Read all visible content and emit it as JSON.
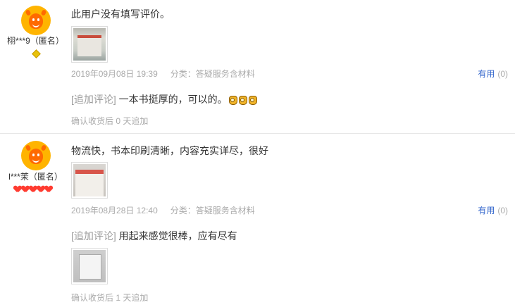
{
  "reviews": [
    {
      "username": "栩***9（匿名）",
      "rank_icons": [
        "diamond-icon"
      ],
      "content": "此用户没有填写评价。",
      "date": "2019年09月08日 19:39",
      "category": "分类：答疑服务含材料",
      "useful_label": "有用",
      "useful_count": "(0)",
      "append_label": "[追加评论]",
      "append_text": "一本书挺厚的，可以的。",
      "append_emoji_count": 3,
      "append_note": "确认收货后 0 天追加"
    },
    {
      "username": "l***茉（匿名）",
      "rank_icons": [
        "heart-icon",
        "heart-icon",
        "heart-icon",
        "heart-icon",
        "heart-icon"
      ],
      "content": "物流快，书本印刷清晰，内容充实详尽，很好",
      "date": "2019年08月28日 12:40",
      "category": "分类：答疑服务含材料",
      "useful_label": "有用",
      "useful_count": "(0)",
      "append_label": "[追加评论]",
      "append_text": "用起来感觉很棒，应有尽有",
      "append_note": "确认收货后 1 天追加"
    }
  ],
  "colors": {
    "link": "#3366cc",
    "muted": "#aaaaaa",
    "avatar": "#ffb400",
    "divider": "#e6e6e6"
  }
}
